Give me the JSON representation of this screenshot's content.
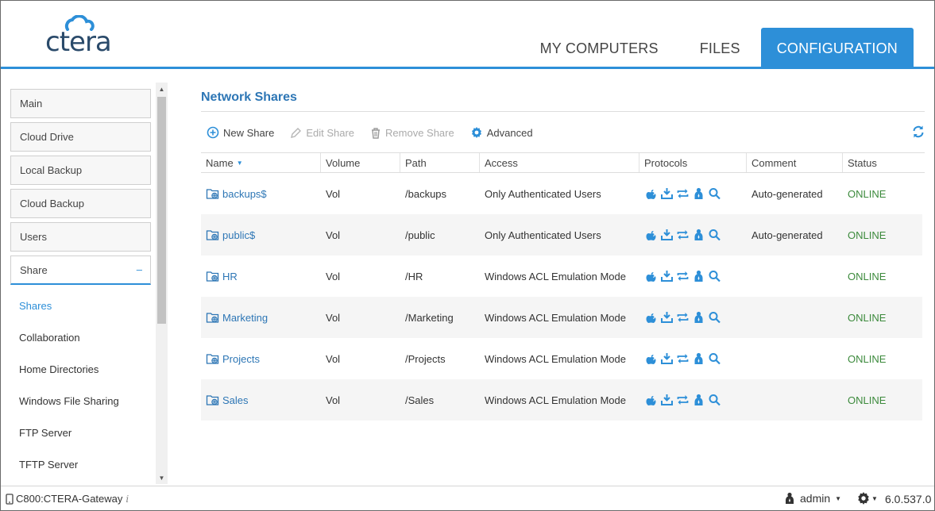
{
  "brand": {
    "logo_text": "ctera"
  },
  "nav": {
    "tabs": [
      {
        "label": "MY COMPUTERS"
      },
      {
        "label": "FILES"
      },
      {
        "label": "CONFIGURATION"
      }
    ],
    "active": "CONFIGURATION"
  },
  "sidebar": {
    "sections": [
      {
        "label": "Main"
      },
      {
        "label": "Cloud Drive"
      },
      {
        "label": "Local Backup"
      },
      {
        "label": "Cloud Backup"
      },
      {
        "label": "Users"
      },
      {
        "label": "Share",
        "expanded_symbol": "–"
      }
    ],
    "sub_items": [
      {
        "label": "Shares"
      },
      {
        "label": "Collaboration"
      },
      {
        "label": "Home Directories"
      },
      {
        "label": "Windows File Sharing"
      },
      {
        "label": "FTP Server"
      },
      {
        "label": "TFTP Server"
      }
    ],
    "active_sub": "Shares"
  },
  "main": {
    "title": "Network Shares",
    "toolbar": {
      "new_share": "New Share",
      "edit_share": "Edit Share",
      "remove_share": "Remove Share",
      "advanced": "Advanced"
    },
    "columns": [
      "Name",
      "Volume",
      "Path",
      "Access",
      "Protocols",
      "Comment",
      "Status"
    ],
    "rows": [
      {
        "name": "backups$",
        "volume": "Vol",
        "path": "/backups",
        "access": "Only Authenticated Users",
        "comment": "Auto-generated",
        "status": "ONLINE"
      },
      {
        "name": "public$",
        "volume": "Vol",
        "path": "/public",
        "access": "Only Authenticated Users",
        "comment": "Auto-generated",
        "status": "ONLINE"
      },
      {
        "name": "HR",
        "volume": "Vol",
        "path": "/HR",
        "access": "Windows ACL Emulation Mode",
        "comment": "",
        "status": "ONLINE"
      },
      {
        "name": "Marketing",
        "volume": "Vol",
        "path": "/Marketing",
        "access": "Windows ACL Emulation Mode",
        "comment": "",
        "status": "ONLINE"
      },
      {
        "name": "Projects",
        "volume": "Vol",
        "path": "/Projects",
        "access": "Windows ACL Emulation Mode",
        "comment": "",
        "status": "ONLINE"
      },
      {
        "name": "Sales",
        "volume": "Vol",
        "path": "/Sales",
        "access": "Windows ACL Emulation Mode",
        "comment": "",
        "status": "ONLINE"
      }
    ],
    "protocol_icons": [
      "apple-icon",
      "download-icon",
      "sync-icon",
      "user-icon",
      "search-icon"
    ]
  },
  "footer": {
    "device": "C800:CTERA-Gateway",
    "info": "i",
    "user": "admin",
    "version": "6.0.537.0"
  },
  "colors": {
    "accent": "#2d8fd8",
    "link": "#2d76b5",
    "online": "#3c8a3c"
  }
}
